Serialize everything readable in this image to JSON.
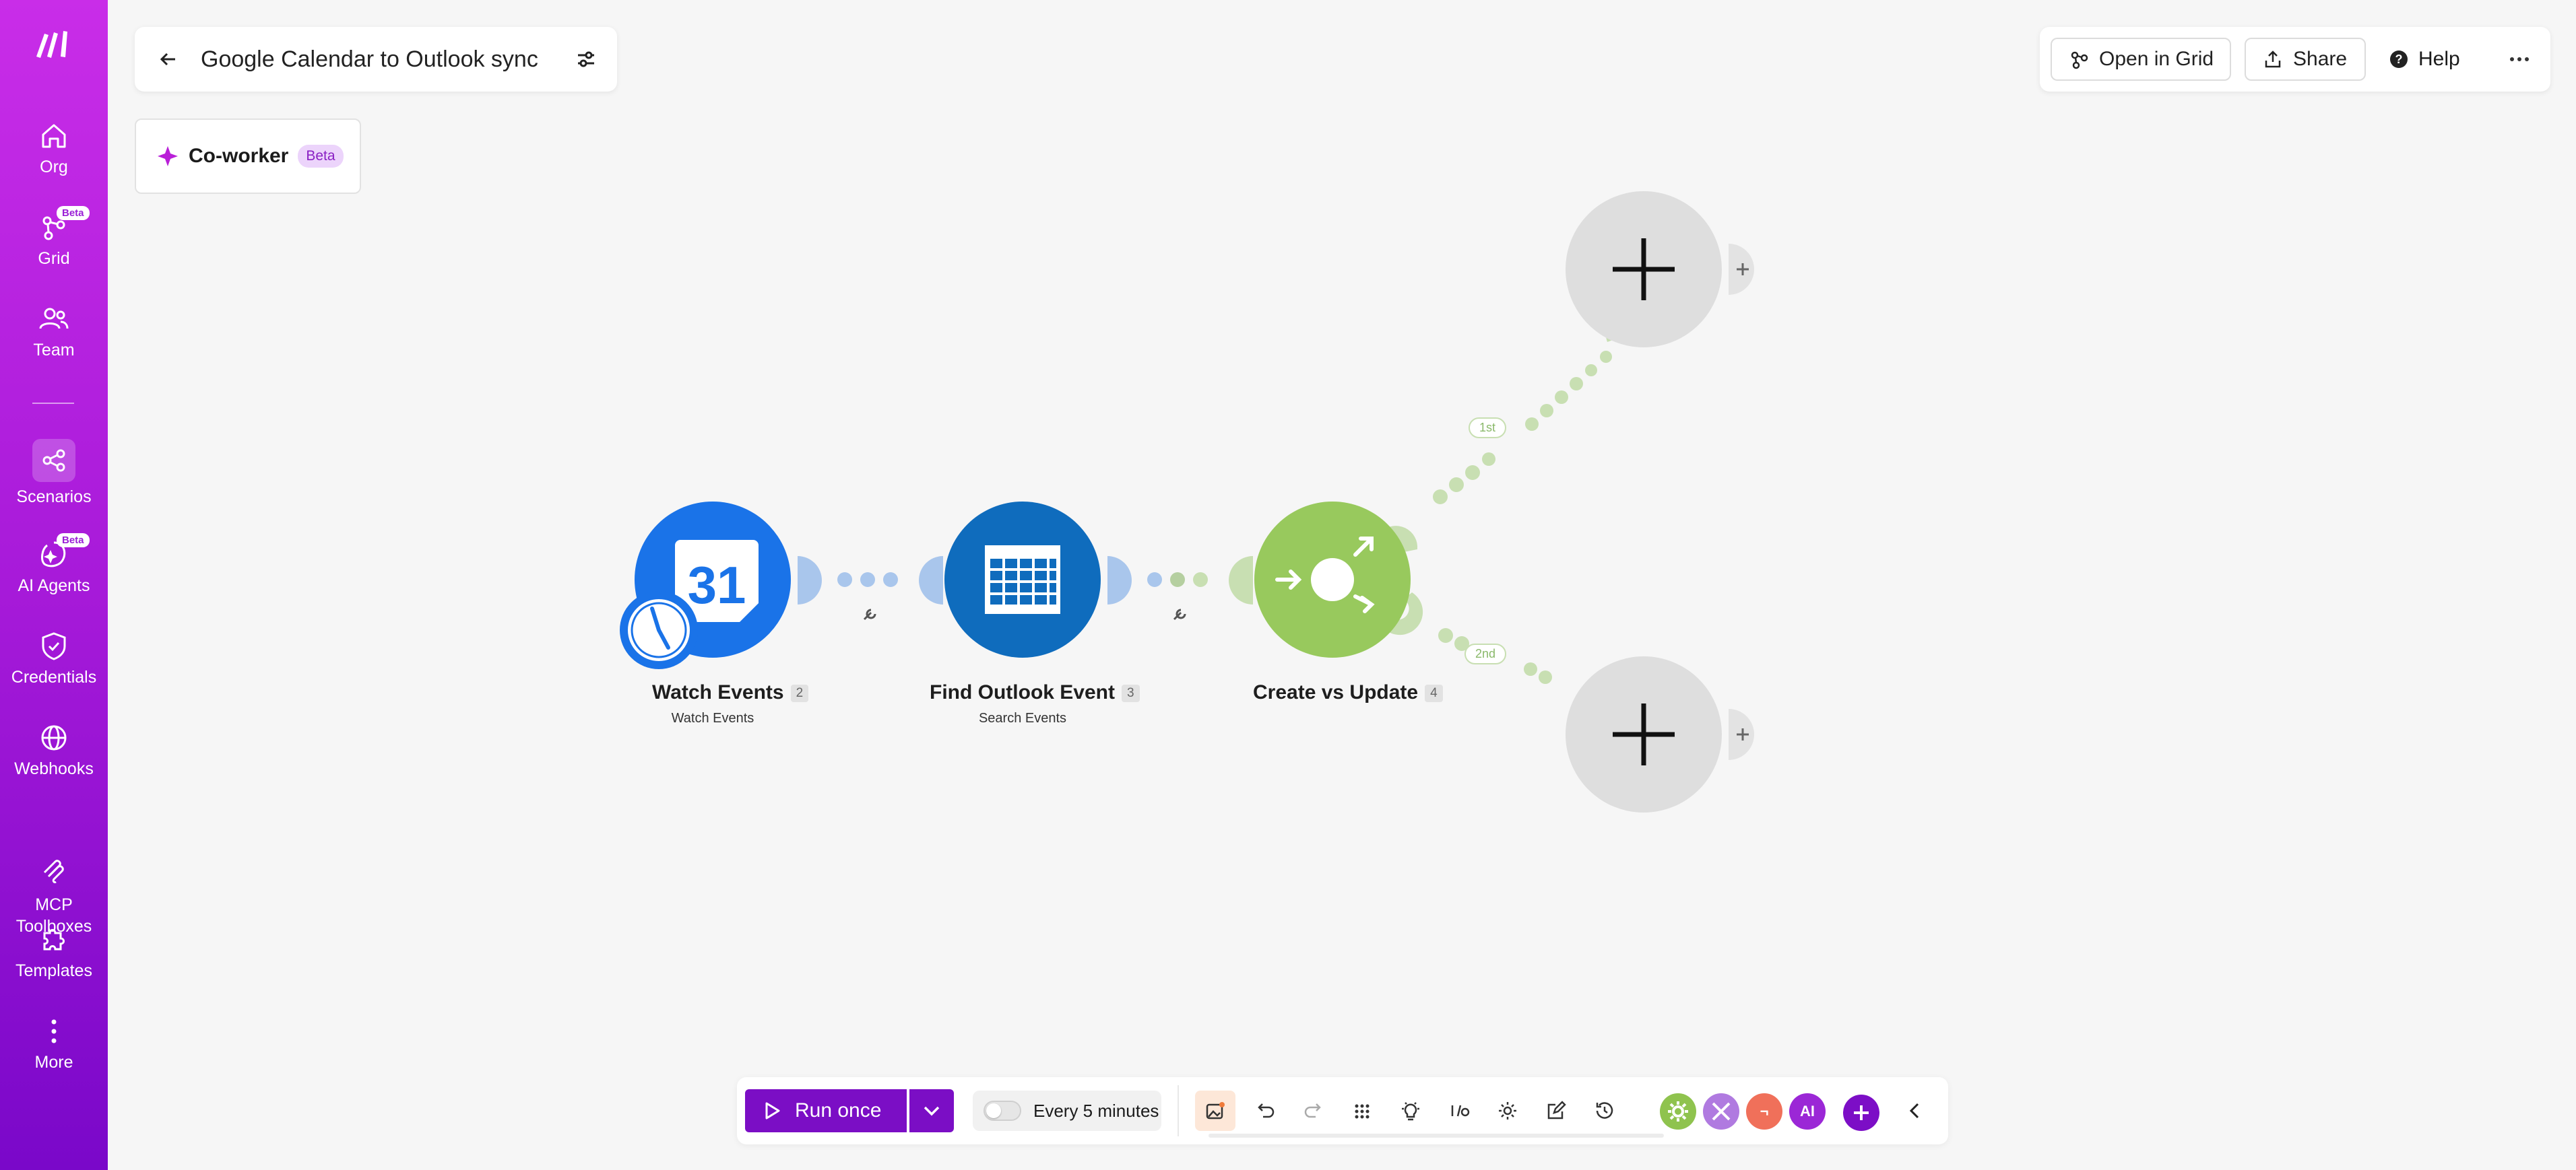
{
  "sidebar": {
    "items": [
      {
        "label": "Org",
        "icon": "home-icon"
      },
      {
        "label": "Grid",
        "icon": "grid-network-icon",
        "badge": "Beta"
      },
      {
        "label": "Team",
        "icon": "team-icon"
      },
      {
        "label": "Scenarios",
        "icon": "share-nodes-icon",
        "active": true
      },
      {
        "label": "AI Agents",
        "icon": "ai-agents-icon",
        "badge": "Beta"
      },
      {
        "label": "Credentials",
        "icon": "shield-check-icon"
      },
      {
        "label": "Webhooks",
        "icon": "globe-icon"
      },
      {
        "label": "MCP\nToolboxes",
        "icon": "mcp-icon"
      },
      {
        "label": "Templates",
        "icon": "puzzle-icon"
      },
      {
        "label": "More",
        "icon": "vertical-dots-icon"
      }
    ]
  },
  "header": {
    "title": "Google Calendar to Outlook sync",
    "coworker_label": "Co-worker",
    "coworker_badge": "Beta"
  },
  "topbar": {
    "open_grid": "Open in Grid",
    "share": "Share",
    "help": "Help"
  },
  "modules": [
    {
      "name": "Watch Events",
      "count": "2",
      "subtitle": "Watch Events",
      "app": "Google Calendar",
      "color": "#1a73e8"
    },
    {
      "name": "Find Outlook Event",
      "count": "3",
      "subtitle": "Search Events",
      "app": "Microsoft Outlook Calendar",
      "color": "#0f6cbd"
    },
    {
      "name": "Create vs Update",
      "count": "4",
      "subtitle": "",
      "app": "Router",
      "color": "#98c95d"
    }
  ],
  "routes": [
    {
      "label": "1st"
    },
    {
      "label": "2nd"
    }
  ],
  "bottombar": {
    "run_label": "Run once",
    "schedule_label": "Every 5 minutes",
    "avatars": [
      {
        "text": "",
        "color": "#8fc34e",
        "icon": "gear-icon"
      },
      {
        "text": "",
        "color": "#b07ae0",
        "icon": "tools-icon"
      },
      {
        "text": "¬",
        "color": "#f0705a",
        "icon": "flow-control-icon"
      },
      {
        "text": "AI",
        "color": "#9b27d6",
        "icon": "ai-icon"
      }
    ]
  },
  "colors": {
    "accent": "#7b0ec5",
    "sidebar_top": "#c92de8",
    "sidebar_bottom": "#7a08c9",
    "router_green": "#98c95d",
    "connector_blue": "#93b8e6"
  }
}
